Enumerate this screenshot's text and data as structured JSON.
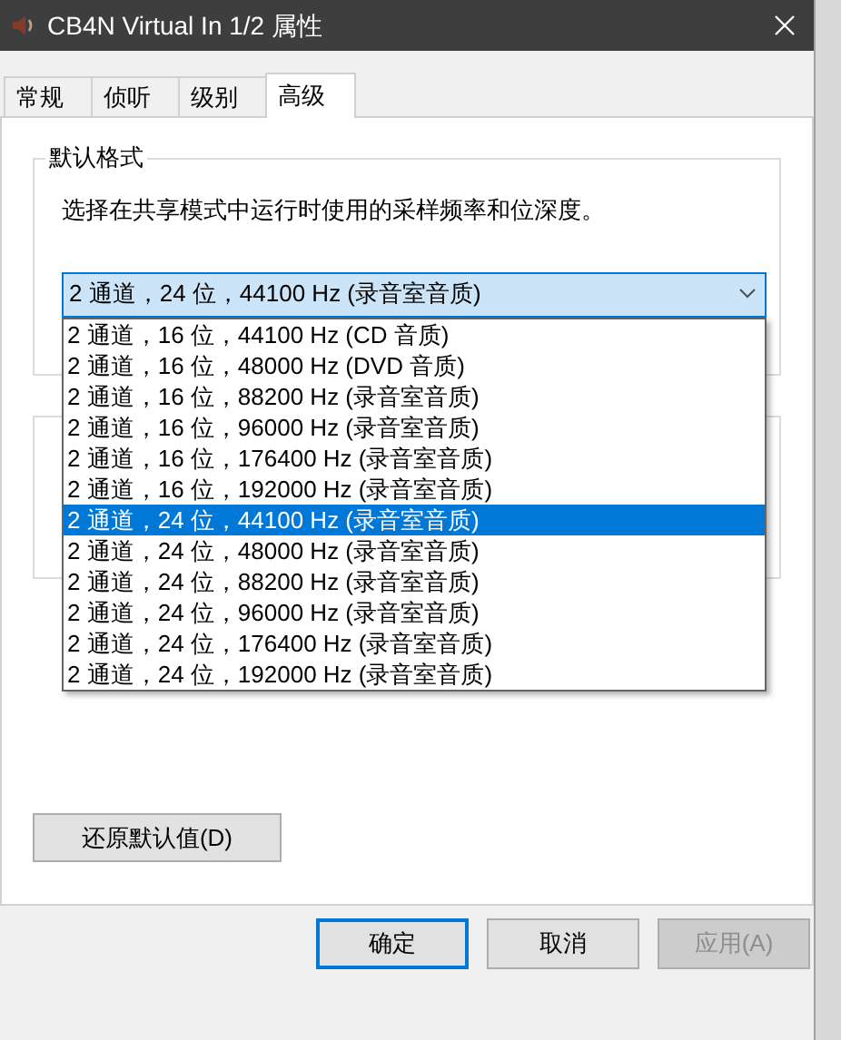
{
  "window": {
    "title": "CB4N Virtual In 1/2 属性"
  },
  "tabs": [
    {
      "label": "常规",
      "selected": false
    },
    {
      "label": "侦听",
      "selected": false
    },
    {
      "label": "级别",
      "selected": false
    },
    {
      "label": "高级",
      "selected": true
    }
  ],
  "default_format": {
    "title": "默认格式",
    "description": "选择在共享模式中运行时使用的采样频率和位深度。",
    "value": "2 通道，24 位，44100 Hz (录音室音质)",
    "options": [
      {
        "label": "2 通道，16 位，44100 Hz (CD 音质)",
        "selected": false
      },
      {
        "label": "2 通道，16 位，48000 Hz (DVD 音质)",
        "selected": false
      },
      {
        "label": "2 通道，16 位，88200 Hz (录音室音质)",
        "selected": false
      },
      {
        "label": "2 通道，16 位，96000 Hz (录音室音质)",
        "selected": false
      },
      {
        "label": "2 通道，16 位，176400 Hz (录音室音质)",
        "selected": false
      },
      {
        "label": "2 通道，16 位，192000 Hz (录音室音质)",
        "selected": false
      },
      {
        "label": "2 通道，24 位，44100 Hz (录音室音质)",
        "selected": true
      },
      {
        "label": "2 通道，24 位，48000 Hz (录音室音质)",
        "selected": false
      },
      {
        "label": "2 通道，24 位，88200 Hz (录音室音质)",
        "selected": false
      },
      {
        "label": "2 通道，24 位，96000 Hz (录音室音质)",
        "selected": false
      },
      {
        "label": "2 通道，24 位，176400 Hz (录音室音质)",
        "selected": false
      },
      {
        "label": "2 通道，24 位，192000 Hz (录音室音质)",
        "selected": false
      }
    ]
  },
  "restore_button": "还原默认值(D)",
  "buttons": [
    {
      "label": "确定",
      "kind": "default",
      "disabled": false
    },
    {
      "label": "取消",
      "kind": "normal",
      "disabled": false
    },
    {
      "label": "应用(A)",
      "kind": "normal",
      "disabled": true
    }
  ]
}
